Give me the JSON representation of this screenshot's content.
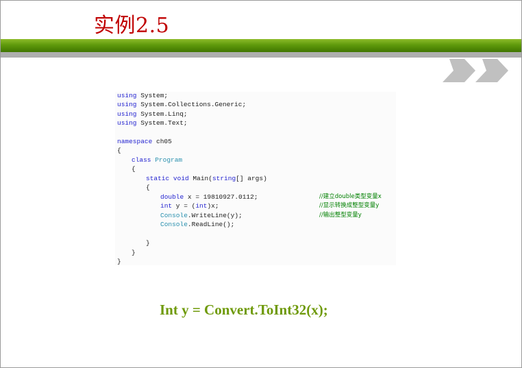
{
  "slide": {
    "title": "实例2.5",
    "emphasis": "Int y = Convert.ToInt32(x);"
  },
  "theme": {
    "title_color": "#c00000",
    "band_green": "#5f9a0c",
    "band_gray": "#aeaeae",
    "chevron_color": "#c0c0c0",
    "emphasis_color": "#6f9a0a"
  },
  "code": {
    "l1_kw": "using",
    "l1_rest": " System;",
    "l2_kw": "using",
    "l2_rest": " System.Collections.Generic;",
    "l3_kw": "using",
    "l3_rest": " System.Linq;",
    "l4_kw": "using",
    "l4_rest": " System.Text;",
    "l5_kw": "namespace",
    "l5_rest": " ch05",
    "l6": "{",
    "l7_kw": "class",
    "l7_type": "Program",
    "l8": "{",
    "l9_kw1": "static",
    "l9_kw2": "void",
    "l9_mid": " Main(",
    "l9_kw3": "string",
    "l9_rest": "[] args)",
    "l10": "{",
    "l11_kw": "double",
    "l11_rest": " x = 19810927.0112;",
    "l11_comment": "//建立double类型变量x",
    "l12_kw": "int",
    "l12_mid": " y = (",
    "l12_kw2": "int",
    "l12_rest": ")x;",
    "l12_comment": "//显示转换成整型变量y",
    "l13_type": "Console",
    "l13_rest": ".WriteLine(y);",
    "l13_comment": "//输出整型变量y",
    "l14_type": "Console",
    "l14_rest": ".ReadLine();",
    "l15": "}",
    "l16": "}",
    "l17": "}"
  },
  "icons": {
    "chevrons": "double-chevron-right-icon"
  }
}
